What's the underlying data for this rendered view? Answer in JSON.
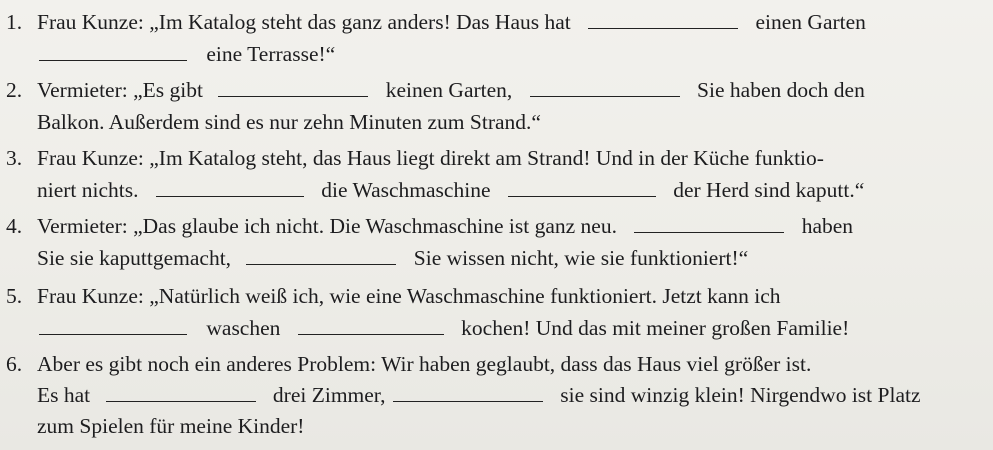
{
  "items": [
    {
      "number": "1.",
      "l1a": "Frau Kunze: „Im Katalog steht das ganz anders! Das Haus hat",
      "l1b": "einen Garten",
      "l2a": "eine Terrasse!“"
    },
    {
      "number": "2.",
      "l1a": "Vermieter: „Es gibt",
      "l1b": "keinen Garten,",
      "l1c": "Sie haben doch den",
      "l2a": "Balkon. Außerdem sind es nur zehn Minuten zum Strand.“"
    },
    {
      "number": "3.",
      "l1a": "Frau Kunze: „Im Katalog steht, das Haus liegt direkt am Strand! Und in der Küche funktio-",
      "l2a": "niert nichts.",
      "l2b": "die Waschmaschine",
      "l2c": "der Herd sind kaputt.“"
    },
    {
      "number": "4.",
      "l1a": "Vermieter: „Das glaube ich nicht. Die Waschmaschine ist ganz neu.",
      "l1b": "haben",
      "l2a": "Sie sie kaputtgemacht,",
      "l2b": "Sie wissen nicht, wie sie funktioniert!“"
    },
    {
      "number": "5.",
      "l1a": "Frau Kunze: „Natürlich weiß ich, wie eine Waschmaschine funktioniert. Jetzt kann ich",
      "l2a": "waschen",
      "l2b": "kochen! Und das mit meiner großen Familie!"
    },
    {
      "number": "6.",
      "l1a": "Aber es gibt noch ein anderes Problem: Wir haben geglaubt, dass das Haus viel größer ist.",
      "l2a": "Es hat",
      "l2b": "drei Zimmer,",
      "l2c": "sie sind winzig klein! Nirgendwo ist Platz",
      "l3a": "zum Spielen für meine Kinder!"
    }
  ]
}
